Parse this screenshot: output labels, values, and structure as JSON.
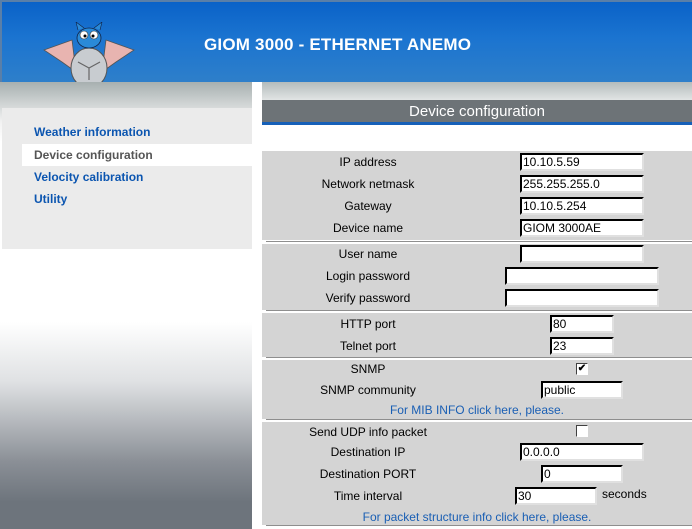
{
  "header": {
    "title": "GIOM 3000 - ETHERNET ANEMO",
    "logo": "bat-mascot-logo"
  },
  "sidebar": {
    "items": [
      {
        "label": "Weather information",
        "active": false
      },
      {
        "label": "Device configuration",
        "active": true
      },
      {
        "label": "Velocity calibration",
        "active": false
      },
      {
        "label": "Utility",
        "active": false
      }
    ]
  },
  "page": {
    "title": "Device configuration"
  },
  "network": {
    "ip_label": "IP address",
    "ip_value": "10.10.5.59",
    "netmask_label": "Network netmask",
    "netmask_value": "255.255.255.0",
    "gateway_label": "Gateway",
    "gateway_value": "10.10.5.254",
    "devname_label": "Device name",
    "devname_value": "GIOM 3000AE"
  },
  "auth": {
    "user_label": "User name",
    "user_value": "",
    "login_label": "Login password",
    "login_value": "",
    "verify_label": "Verify password",
    "verify_value": ""
  },
  "ports": {
    "http_label": "HTTP port",
    "http_value": "80",
    "telnet_label": "Telnet port",
    "telnet_value": "23"
  },
  "snmp": {
    "snmp_label": "SNMP",
    "snmp_checked": true,
    "check_mark": "✔",
    "community_label": "SNMP community",
    "community_value": "public",
    "mib_link": "For MIB INFO click here, please."
  },
  "udp": {
    "send_label": "Send UDP info packet",
    "send_checked": false,
    "dest_ip_label": "Destination IP",
    "dest_ip_value": "0.0.0.0",
    "dest_port_label": "Destination PORT",
    "dest_port_value": "0",
    "interval_label": "Time interval",
    "interval_value": "30",
    "interval_unit": "seconds",
    "packet_link": "For packet structure info click here, please."
  },
  "colors": {
    "header_blue": "#0a62c8",
    "nav_link": "#0b55b0",
    "title_bar": "#6d7377",
    "form_bg": "#d4d4d4",
    "link": "#1a5fb4"
  }
}
